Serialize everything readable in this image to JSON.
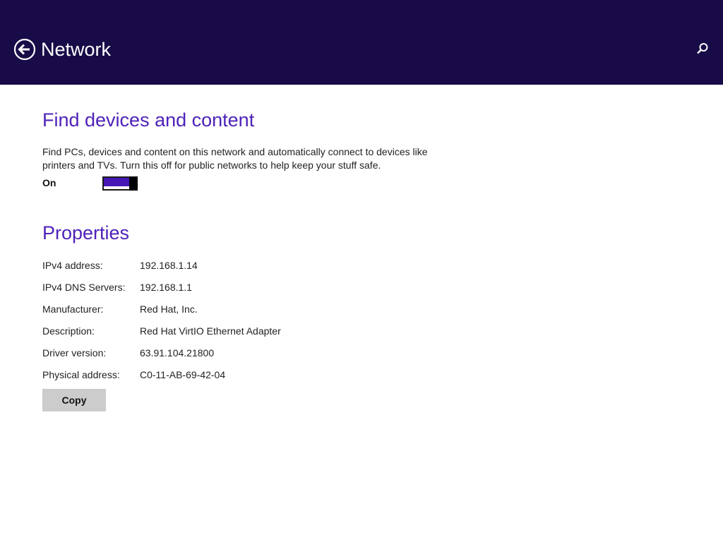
{
  "header": {
    "title": "Network",
    "back_icon": "back-arrow-circle-icon",
    "search_icon": "search-icon",
    "background_color": "#180b48"
  },
  "find_devices": {
    "heading": "Find devices and content",
    "description": "Find PCs, devices and content on this network and automatically connect to devices like printers and TVs. Turn this off for public networks to help keep your stuff safe.",
    "toggle_label": "On",
    "toggle_on": true,
    "accent_color": "#4617b4"
  },
  "properties": {
    "heading": "Properties",
    "rows": [
      {
        "label": "IPv4 address:",
        "value": "192.168.1.14"
      },
      {
        "label": "IPv4 DNS Servers:",
        "value": "192.168.1.1"
      },
      {
        "label": "Manufacturer:",
        "value": "Red Hat, Inc."
      },
      {
        "label": "Description:",
        "value": "Red Hat VirtIO Ethernet Adapter"
      },
      {
        "label": "Driver version:",
        "value": "63.91.104.21800"
      },
      {
        "label": "Physical address:",
        "value": "C0-11-AB-69-42-04"
      }
    ],
    "copy_label": "Copy"
  }
}
